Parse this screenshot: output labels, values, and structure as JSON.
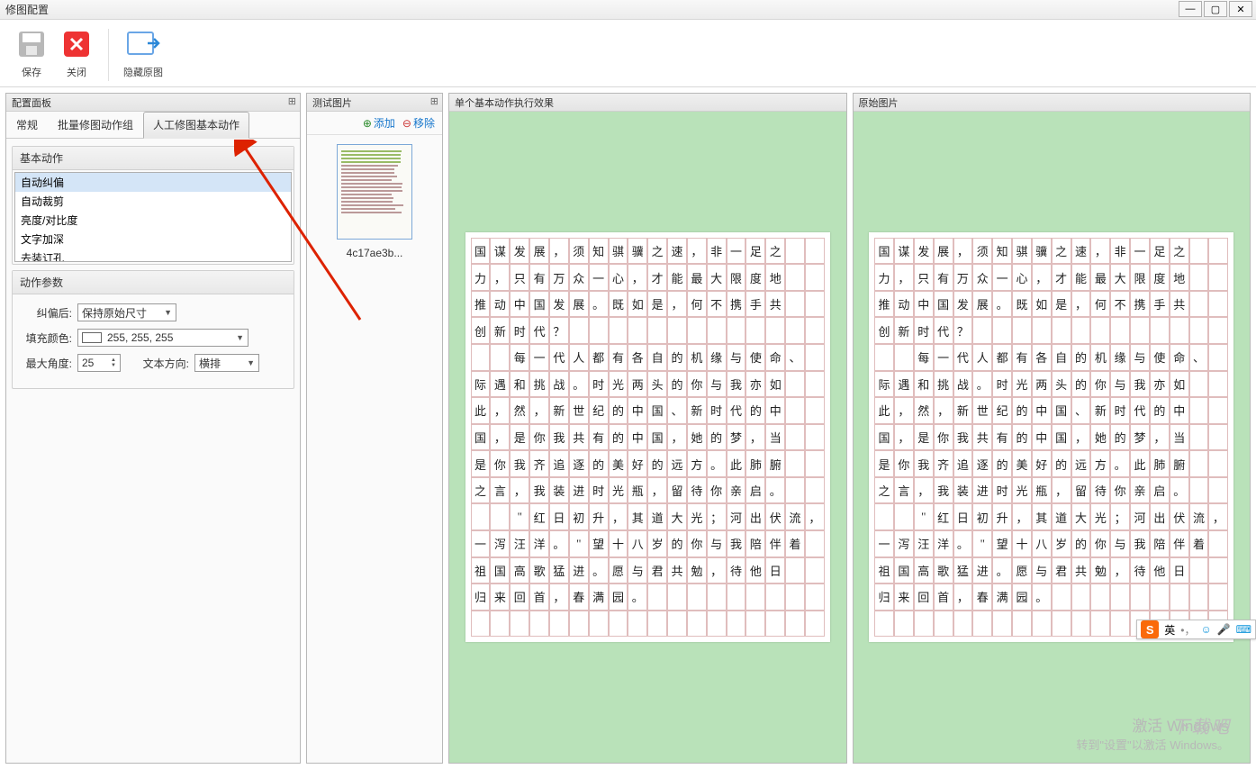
{
  "window": {
    "title": "修图配置"
  },
  "toolbar": {
    "save": "保存",
    "close": "关闭",
    "hide_original": "隐藏原图"
  },
  "config_panel": {
    "title": "配置面板",
    "tabs": {
      "general": "常规",
      "batch": "批量修图动作组",
      "manual": "人工修图基本动作"
    },
    "basic_actions_title": "基本动作",
    "actions": [
      "自动纠偏",
      "自动裁剪",
      "亮度/对比度",
      "文字加深",
      "去装订孔"
    ],
    "params_title": "动作参数",
    "params": {
      "after_correction_label": "纠偏后:",
      "after_correction_value": "保持原始尺寸",
      "fill_color_label": "填充颜色:",
      "fill_color_value": "255, 255, 255",
      "max_angle_label": "最大角度:",
      "max_angle_value": "25",
      "text_direction_label": "文本方向:",
      "text_direction_value": "横排"
    }
  },
  "test_panel": {
    "title": "测试图片",
    "add": "添加",
    "remove": "移除",
    "thumb_label": "4c17ae3b..."
  },
  "views": {
    "result": "单个基本动作执行效果",
    "original": "原始图片"
  },
  "doc_lines": [
    "国谋发展，须知骐骥之速，非一足之",
    "力，只有万众一心，才能最大限度地",
    "推动中国发展。既如是，何不携手共",
    "创新时代？　　　　　　　　　　　",
    "　　每一代人都有各自的机缘与使命、",
    "际遇和挑战。时光两头的你与我亦如",
    "此，然，新世纪的中国、新时代的中",
    "国，是你我共有的中国，她的梦，当",
    "是你我齐追逐的美好的远方。此肺腑",
    "之言，我装进时光瓶，留待你亲启。",
    "　　\"红日初升，其道大光；河出伏流，",
    "一泻汪洋。\"望十八岁的你与我陪伴着",
    "祖国高歌猛进。愿与君共勉，待他日",
    "归来回首，春满园。　　　　　　　",
    "　　　　　　　　　　　　　　　　"
  ],
  "ime": {
    "lang": "英"
  },
  "watermark": {
    "line1": "激活 Windows",
    "line2": "转到\"设置\"以激活 Windows。"
  },
  "watermark2": "下载吧"
}
